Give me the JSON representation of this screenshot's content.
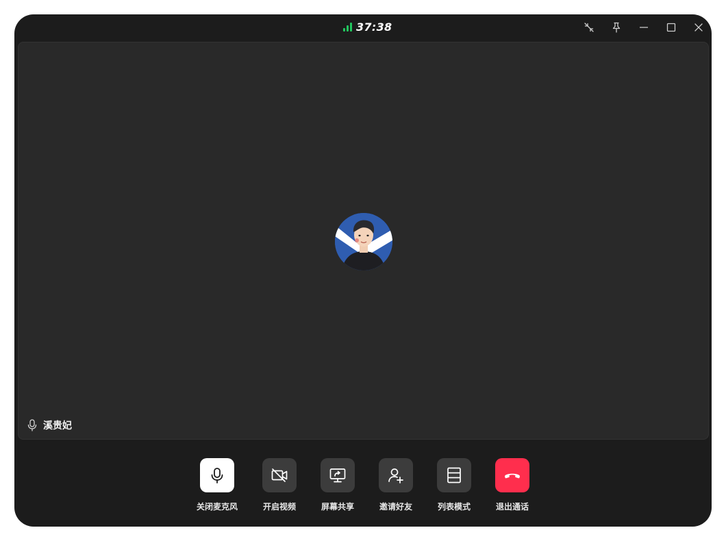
{
  "titlebar": {
    "timer": "37:38",
    "icons": [
      "signal-icon",
      "collapse-icon",
      "pin-icon",
      "minimize-icon",
      "maximize-icon",
      "close-icon"
    ],
    "signal_color": "#22c55e"
  },
  "stage": {
    "speaker_name": "溪贵妃",
    "background": "#292929"
  },
  "controls": [
    {
      "label": "关闭麦克风",
      "icon": "microphone-icon",
      "active": true
    },
    {
      "label": "开启视频",
      "icon": "video-off-icon"
    },
    {
      "label": "屏幕共享",
      "icon": "screen-share-icon"
    },
    {
      "label": "邀请好友",
      "icon": "invite-user-icon"
    },
    {
      "label": "列表模式",
      "icon": "list-layout-icon"
    },
    {
      "label": "退出通话",
      "icon": "hang-up-icon",
      "color": "#ff2e4d"
    }
  ]
}
